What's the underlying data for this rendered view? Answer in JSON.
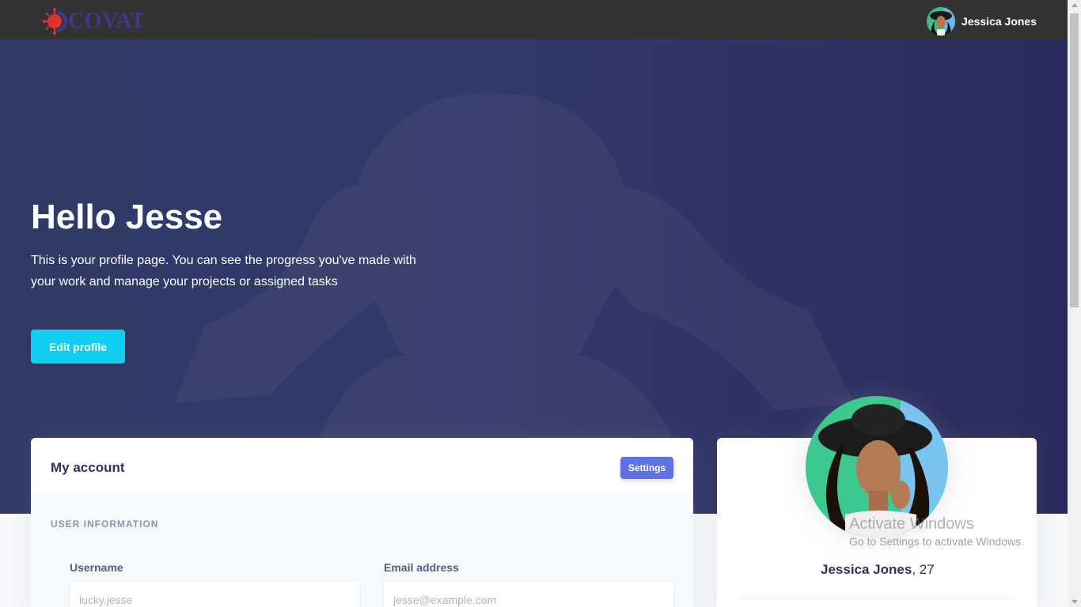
{
  "brand": {
    "name": "COVAT"
  },
  "nav": {
    "user_name": "Jessica Jones"
  },
  "hero": {
    "greeting": "Hello Jesse",
    "description": "This is your profile page. You can see the progress you've made with your work and manage your projects or assigned tasks",
    "edit_button": "Edit profile"
  },
  "account": {
    "title": "My account",
    "settings_button": "Settings",
    "section_title": "USER INFORMATION",
    "username_label": "Username",
    "username_placeholder": "lucky.jesse",
    "email_label": "Email address",
    "email_placeholder": "jesse@example.com"
  },
  "profile": {
    "name": "Jessica Jones",
    "age": ", 27"
  },
  "watermark": {
    "title": "Activate Windows",
    "subtitle": "Go to Settings to activate Windows."
  },
  "colors": {
    "topbar": "#333333",
    "hero": "#2f3a66",
    "accent_cyan": "#11cdef",
    "primary": "#5e72e4",
    "heading": "#32325d"
  }
}
